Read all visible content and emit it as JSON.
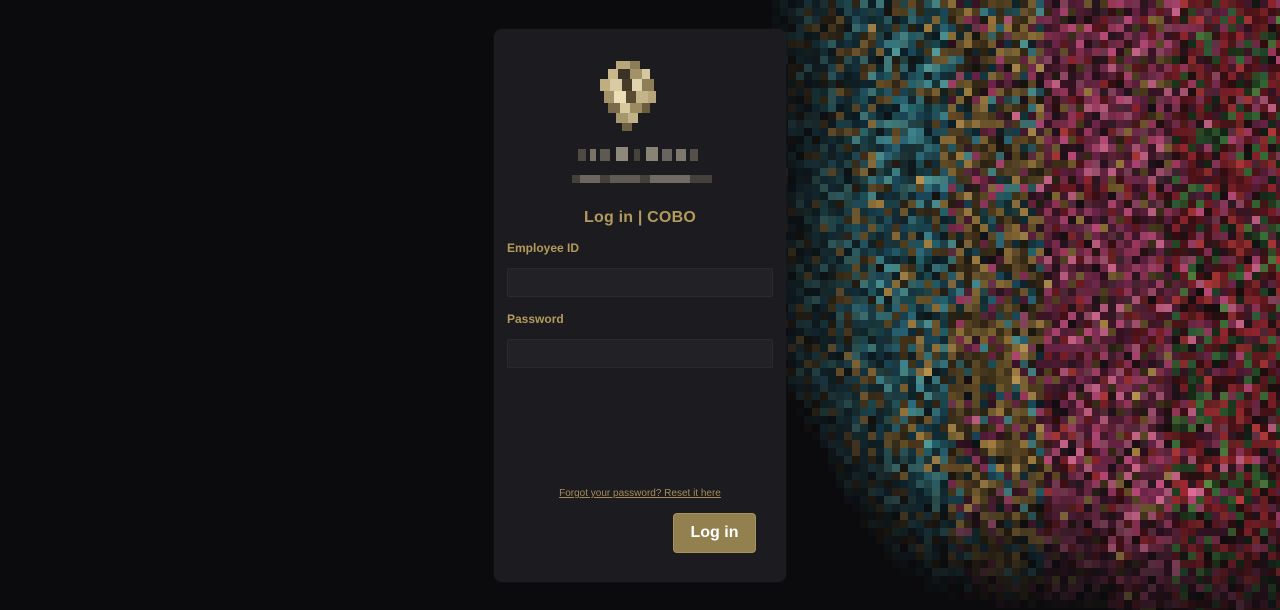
{
  "login": {
    "title": "Log in | COBO",
    "employee_id_label": "Employee ID",
    "employee_id_value": "",
    "password_label": "Password",
    "password_value": "",
    "forgot_link": "Forgot your password? Reset it here",
    "submit_label": "Log in"
  },
  "icons": {
    "logo": "company-logo-icon",
    "background": "lion-artwork-image"
  },
  "colors": {
    "page_background": "#0b0b0d",
    "card_background": "#1c1c20",
    "accent_gold": "#b39a5c",
    "button_background": "#93804f",
    "input_background": "#222226"
  }
}
